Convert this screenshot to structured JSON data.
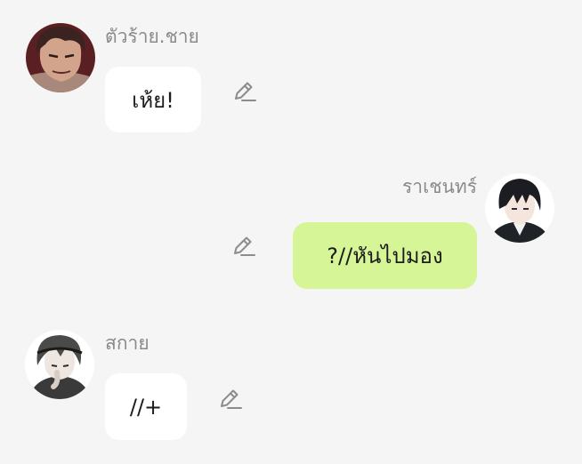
{
  "messages": [
    {
      "sender": "ตัวร้าย.ชาย",
      "text": "เห้ย!",
      "side": "left",
      "bubble_color": "#ffffff",
      "action_icon": "pencil-edit-icon"
    },
    {
      "sender": "ราเชนทร์",
      "text": "?//หันไปมอง",
      "side": "right",
      "bubble_color": "#d6f596",
      "action_icon": "pencil-edit-icon"
    },
    {
      "sender": "สกาย",
      "text": "//+",
      "side": "left",
      "bubble_color": "#ffffff",
      "action_icon": "pencil-edit-icon"
    }
  ],
  "theme": {
    "background": "#f5f5f5",
    "name_color": "#8a8a8a",
    "icon_color": "#8c8c8c"
  }
}
